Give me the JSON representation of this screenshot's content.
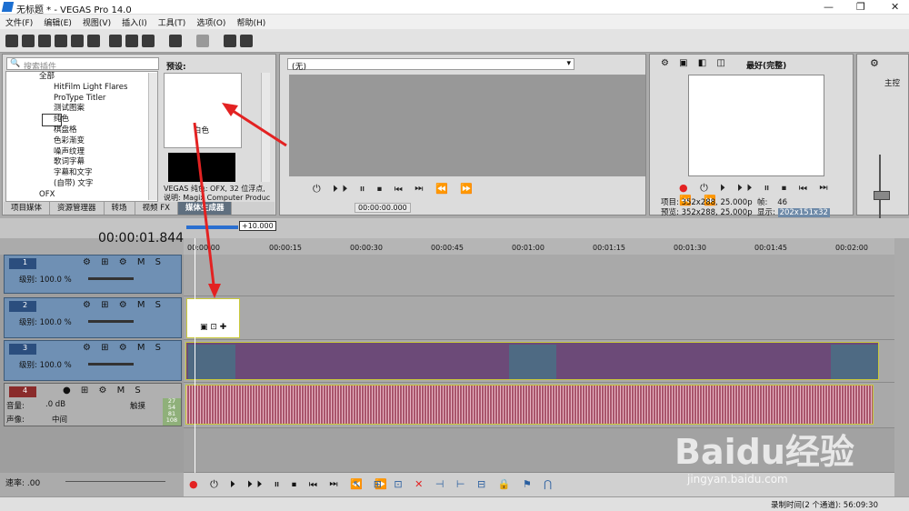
{
  "window": {
    "title": "无标题 * - VEGAS Pro 14.0"
  },
  "menu": [
    "文件(F)",
    "编辑(E)",
    "视图(V)",
    "插入(I)",
    "工具(T)",
    "选项(O)",
    "帮助(H)"
  ],
  "plugin_panel": {
    "search_placeholder": "搜索插件",
    "tree_items": [
      "全部",
      "HitFilm Light Flares",
      "ProType Titler",
      "测试图案",
      "纯色",
      "棋盘格",
      "色彩渐变",
      "噪声纹理",
      "歌词字幕",
      "字幕和文字",
      "(自带) 文字",
      "OFX"
    ],
    "selected_item": "纯色",
    "preset_label": "预设:",
    "preset_white": "白色",
    "info_line1": "VEGAS 纯色: OFX, 32 位浮点,",
    "info_line2": "说明: Magix Computer Produc",
    "tabs": [
      "项目媒体",
      "资源管理器",
      "转场",
      "视频 FX",
      "媒体生成器"
    ],
    "active_tab": "媒体生成器"
  },
  "trimmer": {
    "dropdown_value": "(无)",
    "timecode": "00:00:00.000"
  },
  "preview": {
    "quality": "最好(完整)",
    "project_info": "项目: 352x288, 25.000p",
    "frame_label": "帧:",
    "frame_value": "46",
    "preview_info": "预览: 352x288, 25.000p",
    "display_label": "显示:",
    "display_value": "202x151x32"
  },
  "mixer": {
    "label": "主控"
  },
  "timeline": {
    "timecode": "00:00:01.844",
    "offset_badge": "+10.000",
    "ruler_labels": [
      "00:00:00",
      "00:00:15",
      "00:00:30",
      "00:00:45",
      "00:01:00",
      "00:01:15",
      "00:01:30",
      "00:01:45",
      "00:02:00"
    ],
    "rate_label": "速率: .00",
    "status_text": "录制时间(2 个通道): 56:09:30"
  },
  "tracks": [
    {
      "num": "1",
      "type": "video",
      "level_label": "级别: 100.0 %"
    },
    {
      "num": "2",
      "type": "video",
      "level_label": "级别: 100.0 %"
    },
    {
      "num": "3",
      "type": "video",
      "level_label": "级别: 100.0 %"
    },
    {
      "num": "4",
      "type": "audio",
      "vol_label": "音量:",
      "vol_value": ".0 dB",
      "pan_label": "声像:",
      "pan_value": "中间",
      "mode": "触摸",
      "meter": [
        "27",
        "54",
        "81",
        "108"
      ]
    }
  ],
  "watermark": {
    "text": "Baidu经验",
    "url": "jingyan.baidu.com"
  },
  "colors": {
    "accent": "#e32222",
    "clip_video": "#6c4a78",
    "clip_audio": "#a9556c",
    "track_head": "#6f90b4"
  }
}
